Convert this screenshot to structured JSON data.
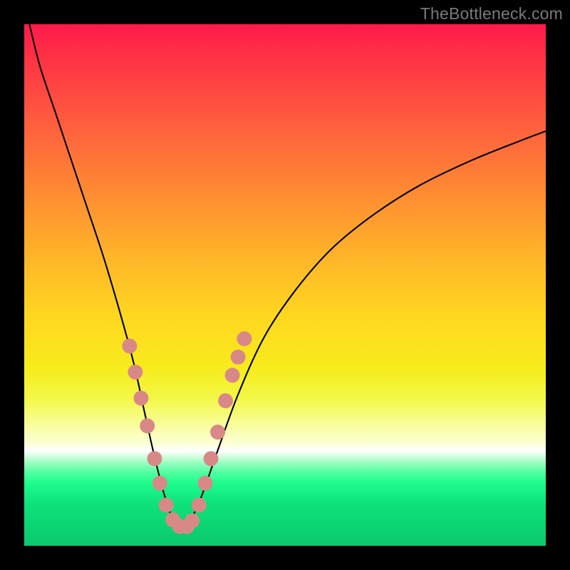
{
  "watermark": "TheBottleneck.com",
  "colors": {
    "curve": "#000000",
    "dot_fill": "#d98888",
    "dot_stroke": "#c46f6f",
    "frame": "#000000"
  },
  "chart_data": {
    "type": "line",
    "title": "",
    "xlabel": "",
    "ylabel": "",
    "xlim": [
      0,
      1
    ],
    "ylim": [
      0,
      1
    ],
    "note": "Axes carry no tick labels or numeric scale in the source image; x and y are normalized 0–1 within the plot area. y is expressed with 0 at the bottom (closer to 0 = lower bottleneck). The V-shaped curve bottoms out near x≈0.30.",
    "series": [
      {
        "name": "bottleneck-curve",
        "x": [
          0.01,
          0.03,
          0.06,
          0.09,
          0.12,
          0.15,
          0.18,
          0.21,
          0.232,
          0.25,
          0.268,
          0.285,
          0.3,
          0.318,
          0.34,
          0.37,
          0.41,
          0.46,
          0.52,
          0.59,
          0.67,
          0.76,
          0.86,
          0.96,
          1.0
        ],
        "y": [
          1.0,
          0.92,
          0.83,
          0.74,
          0.65,
          0.56,
          0.46,
          0.35,
          0.25,
          0.17,
          0.1,
          0.05,
          0.03,
          0.048,
          0.095,
          0.18,
          0.29,
          0.4,
          0.49,
          0.57,
          0.635,
          0.692,
          0.74,
          0.78,
          0.795
        ]
      }
    ],
    "markers": {
      "name": "highlighted-dots",
      "note": "Approximate normalized positions of the salmon dots on the curve near the valley.",
      "points": [
        {
          "x": 0.202,
          "y": 0.383
        },
        {
          "x": 0.213,
          "y": 0.333
        },
        {
          "x": 0.224,
          "y": 0.283
        },
        {
          "x": 0.236,
          "y": 0.23
        },
        {
          "x": 0.25,
          "y": 0.167
        },
        {
          "x": 0.26,
          "y": 0.12
        },
        {
          "x": 0.272,
          "y": 0.078
        },
        {
          "x": 0.285,
          "y": 0.05
        },
        {
          "x": 0.298,
          "y": 0.037
        },
        {
          "x": 0.312,
          "y": 0.037
        },
        {
          "x": 0.322,
          "y": 0.048
        },
        {
          "x": 0.335,
          "y": 0.078
        },
        {
          "x": 0.347,
          "y": 0.12
        },
        {
          "x": 0.358,
          "y": 0.167
        },
        {
          "x": 0.371,
          "y": 0.218
        },
        {
          "x": 0.386,
          "y": 0.278
        },
        {
          "x": 0.399,
          "y": 0.327
        },
        {
          "x": 0.41,
          "y": 0.362
        },
        {
          "x": 0.422,
          "y": 0.397
        }
      ]
    }
  }
}
